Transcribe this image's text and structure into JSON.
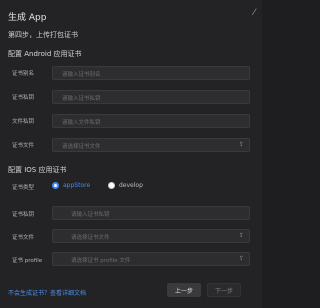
{
  "dialog": {
    "title": "生成 App",
    "close_icon": "close-icon",
    "description": "第四步，上传打包证书"
  },
  "android": {
    "section_title": "配置 Android 应用证书",
    "fields": [
      {
        "label": "证书别名",
        "placeholder": "请输入证书别名"
      },
      {
        "label": "证书私钥",
        "placeholder": "请输入证书私钥"
      },
      {
        "label": "文件私钥",
        "placeholder": "请输入文件私钥"
      },
      {
        "label": "证书文件",
        "placeholder": "请选择证书文件",
        "icon": "upload-icon"
      }
    ]
  },
  "ios": {
    "section_title": "配置 IOS 应用证书",
    "cert_type_label": "证书类型",
    "options": [
      {
        "label": "appStore",
        "selected": true
      },
      {
        "label": "develop",
        "selected": false
      }
    ],
    "fields": [
      {
        "label": "证书私钥",
        "placeholder": "请输入证书私钥"
      },
      {
        "label": "证书文件",
        "placeholder": "请选择证书文件",
        "icon": "upload-icon"
      },
      {
        "label": "证书 profile",
        "placeholder": "请选择证书 profile 文件",
        "icon": "upload-icon"
      }
    ]
  },
  "footer": {
    "link_text": "不会生成证书？查看详细文档",
    "prev_label": "上一步",
    "next_label": "下一步"
  },
  "colors": {
    "accent": "#3d8bff",
    "background": "#232325"
  }
}
